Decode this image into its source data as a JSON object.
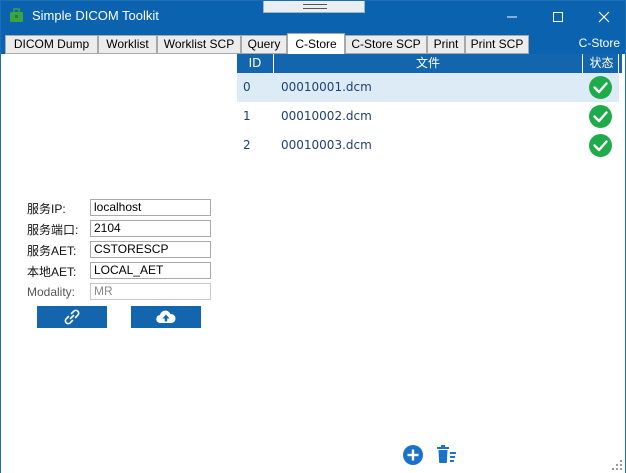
{
  "window": {
    "title": "Simple DICOM Toolkit",
    "current_tab_label": "C-Store"
  },
  "tabs": [
    {
      "label": "DICOM Dump"
    },
    {
      "label": "Worklist"
    },
    {
      "label": "Worklist SCP"
    },
    {
      "label": "Query"
    },
    {
      "label": "C-Store"
    },
    {
      "label": "C-Store SCP"
    },
    {
      "label": "Print"
    },
    {
      "label": "Print SCP"
    }
  ],
  "active_tab": "C-Store",
  "grid": {
    "columns": [
      "ID",
      "文件",
      "状态"
    ],
    "rows": [
      {
        "id": "0",
        "file": "00010001.dcm",
        "status": "success-check-icon"
      },
      {
        "id": "1",
        "file": "00010002.dcm",
        "status": "success-check-icon"
      },
      {
        "id": "2",
        "file": "00010003.dcm",
        "status": "success-check-icon"
      }
    ]
  },
  "form": {
    "server_ip_label": "服务IP:",
    "server_ip_value": "localhost",
    "server_port_label": "服务端口:",
    "server_port_value": "2104",
    "server_aet_label": "服务AET:",
    "server_aet_value": "CSTORESCP",
    "local_aet_label": "本地AET:",
    "local_aet_value": "LOCAL_AET",
    "modality_label": "Modality:",
    "modality_value": "MR"
  },
  "icons": {
    "connect": "link-icon",
    "upload": "cloud-upload-icon",
    "add": "add-circle-icon",
    "delete": "delete-icon"
  },
  "colors": {
    "accent": "#0b63b0",
    "header": "#1366ad",
    "success": "#1fab4a",
    "selected_row": "#dcebf6"
  }
}
